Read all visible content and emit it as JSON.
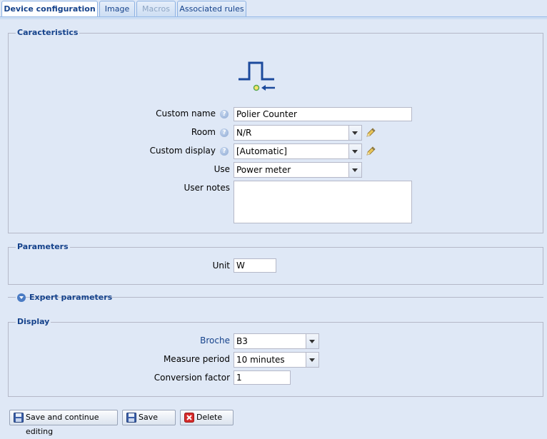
{
  "tabs": [
    {
      "label": "Device configuration",
      "state": "active"
    },
    {
      "label": "Image",
      "state": "normal"
    },
    {
      "label": "Macros",
      "state": "disabled"
    },
    {
      "label": "Associated rules",
      "state": "normal"
    }
  ],
  "characteristics": {
    "legend": "Caracteristics",
    "device_icon": "pulse-counter-icon",
    "custom_name": {
      "label": "Custom name",
      "value": "Polier Counter"
    },
    "room": {
      "label": "Room",
      "value": "N/R"
    },
    "custom_display": {
      "label": "Custom display",
      "value": "[Automatic]"
    },
    "use": {
      "label": "Use",
      "value": "Power meter"
    },
    "user_notes": {
      "label": "User notes",
      "value": ""
    }
  },
  "parameters": {
    "legend": "Parameters",
    "unit": {
      "label": "Unit",
      "value": "W"
    }
  },
  "expert": {
    "label": "Expert parameters"
  },
  "display": {
    "legend": "Display",
    "broche": {
      "label": "Broche",
      "value": "B3"
    },
    "measure_period": {
      "label": "Measure period",
      "value": "10 minutes"
    },
    "conversion_factor": {
      "label": "Conversion factor",
      "value": "1"
    }
  },
  "buttons": {
    "save_continue": "Save and continue editing",
    "save": "Save",
    "delete": "Delete"
  },
  "colors": {
    "accent": "#15428b",
    "background": "#dfe8f6",
    "delete": "#d62b2b"
  }
}
